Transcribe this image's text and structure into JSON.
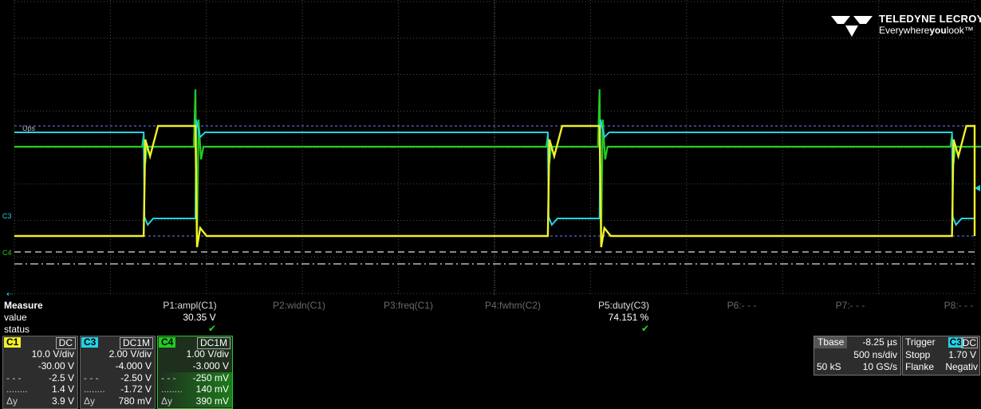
{
  "scope": {
    "brand_name": "TELEDYNE LECROY",
    "brand_tagline_pre": "Everywhere",
    "brand_tagline_you": "you",
    "brand_tagline_post": "look",
    "marker_trigger_label": "C3",
    "marker_c4_label": "C4",
    "marker_top_label": "Ups"
  },
  "colors": {
    "c1": "#f0f028",
    "c3": "#22d3e6",
    "c4": "#22cc22",
    "grid": "#4a4a4a",
    "panel": "#2d2d2d"
  },
  "measure": {
    "title": "Measure",
    "row_value": "value",
    "row_status": "status",
    "params": [
      {
        "label": "P1:ampl(C1)",
        "value": "30.35 V",
        "status": "✔"
      },
      {
        "label": "P2:widn(C1)",
        "value": "",
        "status": ""
      },
      {
        "label": "P3:freq(C1)",
        "value": "",
        "status": ""
      },
      {
        "label": "P4:fwhm(C2)",
        "value": "",
        "status": ""
      },
      {
        "label": "P5:duty(C3)",
        "value": "74.151 %",
        "status": "✔"
      },
      {
        "label": "P6:- - -",
        "value": "",
        "status": ""
      },
      {
        "label": "P7:- - -",
        "value": "",
        "status": ""
      },
      {
        "label": "P8:- - -",
        "value": "",
        "status": ""
      }
    ]
  },
  "channels": [
    {
      "name": "C1",
      "coupling": "DC",
      "vdiv": "10.0 V/div",
      "offset": "-30.00 V",
      "cursor1": "-2.5 V",
      "cursor2": "1.4 V",
      "delta_label": "Δy",
      "delta": "3.9 V"
    },
    {
      "name": "C3",
      "coupling": "DC1M",
      "vdiv": "2.00 V/div",
      "offset": "-4.000 V",
      "cursor1": "-2.50 V",
      "cursor2": "-1.72 V",
      "delta_label": "Δy",
      "delta": "780 mV"
    },
    {
      "name": "C4",
      "coupling": "DC1M",
      "vdiv": "1.00 V/div",
      "offset": "-3.000 V",
      "cursor1": "-250 mV",
      "cursor2": "140 mV",
      "delta_label": "Δy",
      "delta": "390 mV"
    }
  ],
  "timebase": {
    "title": "Tbase",
    "delay": "-8.25 µs",
    "tdiv": "500 ns/div",
    "samples": "50 kS",
    "rate": "10 GS/s"
  },
  "trigger": {
    "title": "Trigger",
    "source": "C3",
    "coupling": "DC",
    "mode": "Stopp",
    "level": "1.70 V",
    "slope_label": "Flanke",
    "slope": "Negativ"
  },
  "waveform": {
    "period_us": 2.5,
    "high_time_us": 0.32,
    "edge_times_us": [
      0.8,
      3.3,
      5.8
    ],
    "screen_span_us": 5.94
  }
}
